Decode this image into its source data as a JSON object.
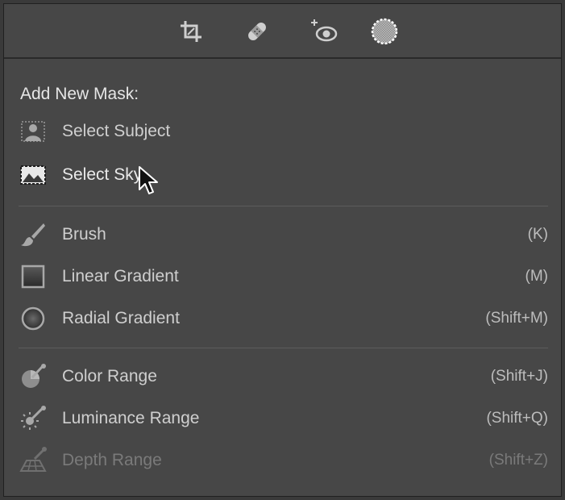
{
  "toolbar": {
    "tools": [
      {
        "name": "crop-icon"
      },
      {
        "name": "healing-icon"
      },
      {
        "name": "red-eye-icon"
      },
      {
        "name": "masking-icon",
        "active": true
      }
    ]
  },
  "menu": {
    "heading": "Add New Mask:",
    "ai_items": [
      {
        "label": "Select Subject",
        "icon": "select-subject-icon"
      },
      {
        "label": "Select Sky",
        "icon": "select-sky-icon"
      }
    ],
    "tool_items": [
      {
        "label": "Brush",
        "shortcut": "(K)",
        "icon": "brush-icon"
      },
      {
        "label": "Linear Gradient",
        "shortcut": "(M)",
        "icon": "linear-gradient-icon"
      },
      {
        "label": "Radial Gradient",
        "shortcut": "(Shift+M)",
        "icon": "radial-gradient-icon"
      }
    ],
    "range_items": [
      {
        "label": "Color Range",
        "shortcut": "(Shift+J)",
        "icon": "color-range-icon"
      },
      {
        "label": "Luminance Range",
        "shortcut": "(Shift+Q)",
        "icon": "luminance-range-icon"
      },
      {
        "label": "Depth Range",
        "shortcut": "(Shift+Z)",
        "icon": "depth-range-icon",
        "disabled": true
      }
    ]
  }
}
